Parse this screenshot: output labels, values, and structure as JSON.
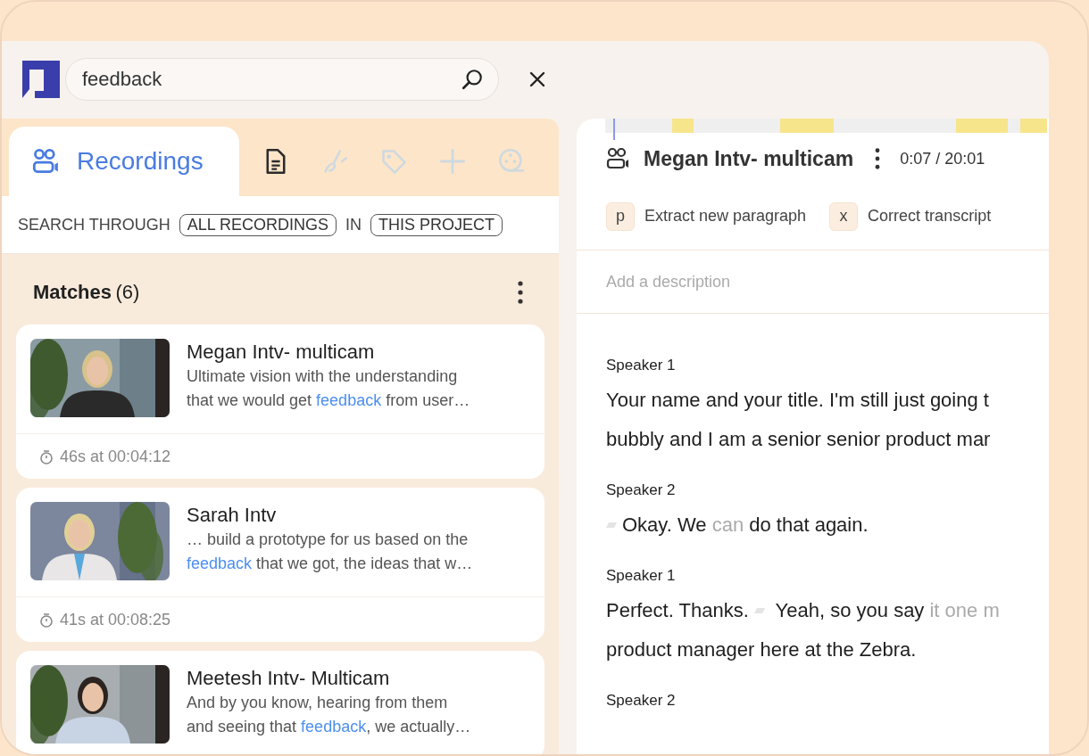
{
  "search": {
    "value": "feedback"
  },
  "tabs": [
    {
      "kind": "recordings",
      "label": "Recordings",
      "selected": true,
      "disabled": false
    },
    {
      "kind": "document",
      "selected": false,
      "disabled": false
    },
    {
      "kind": "brush",
      "selected": false,
      "disabled": true
    },
    {
      "kind": "tag",
      "selected": false,
      "disabled": true
    },
    {
      "kind": "add",
      "selected": false,
      "disabled": true
    },
    {
      "kind": "reel",
      "selected": false,
      "disabled": true
    }
  ],
  "scope": [
    {
      "kind": "text",
      "text": "SEARCH THROUGH"
    },
    {
      "kind": "chip",
      "text": "ALL RECORDINGS"
    },
    {
      "kind": "text",
      "text": "IN"
    },
    {
      "kind": "chip",
      "text": "THIS PROJECT"
    }
  ],
  "matches": {
    "title": "Matches",
    "count": "(6)",
    "items": [
      {
        "title": "Megan Intv- multicam",
        "snippet": [
          [
            {
              "text": "Ultimate vision with the understanding",
              "highlight": false
            }
          ],
          [
            {
              "text": "that we would get ",
              "highlight": false
            },
            {
              "text": "feedback",
              "highlight": true
            },
            {
              "text": " from user…",
              "highlight": false
            }
          ]
        ],
        "meta": "46s at 00:04:12"
      },
      {
        "title": "Sarah Intv",
        "snippet": [
          [
            {
              "text": "… build a prototype for us based on the",
              "highlight": false
            }
          ],
          [
            {
              "text": "feedback",
              "highlight": true
            },
            {
              "text": " that we got, the ideas that w…",
              "highlight": false
            }
          ]
        ],
        "meta": "41s at 00:08:25"
      },
      {
        "title": "Meetesh Intv- Multicam",
        "snippet": [
          [
            {
              "text": "And by you know, hearing from them",
              "highlight": false
            }
          ],
          [
            {
              "text": "and seeing that ",
              "highlight": false
            },
            {
              "text": "feedback",
              "highlight": true
            },
            {
              "text": ", we actually…",
              "highlight": false
            }
          ]
        ]
      }
    ]
  },
  "recording": {
    "title": "Megan Intv- multicam",
    "time": "0:07 / 20:01",
    "shortcuts": [
      {
        "key": "p",
        "label": "Extract new paragraph"
      },
      {
        "key": "x",
        "label": "Correct transcript"
      }
    ],
    "description": {
      "placeholder": "Add a description"
    },
    "transcript": [
      {
        "speaker": "Speaker 1",
        "lines": [
          [
            {
              "kind": "word",
              "text": "Your name and your title. I'm still just going t",
              "dim": false
            }
          ],
          [
            {
              "kind": "word",
              "text": "bubbly and I am a senior senior product mar",
              "dim": false
            }
          ]
        ]
      },
      {
        "speaker": "Speaker 2",
        "lines": [
          [
            {
              "kind": "pause"
            },
            {
              "kind": "word",
              "text": "Okay. We ",
              "dim": false
            },
            {
              "kind": "word",
              "text": "can",
              "dim": true
            },
            {
              "kind": "word",
              "text": " do that again.",
              "dim": false
            }
          ]
        ]
      },
      {
        "speaker": "Speaker 1",
        "lines": [
          [
            {
              "kind": "word",
              "text": "Perfect. Thanks. ",
              "dim": false
            },
            {
              "kind": "pause"
            },
            {
              "kind": "word",
              "text": " Yeah, so you say ",
              "dim": false
            },
            {
              "kind": "word",
              "text": "it one m",
              "dim": true
            }
          ],
          [
            {
              "kind": "word",
              "text": "product manager here at the Zebra.",
              "dim": false
            }
          ]
        ]
      },
      {
        "speaker": "Speaker 2"
      }
    ]
  }
}
